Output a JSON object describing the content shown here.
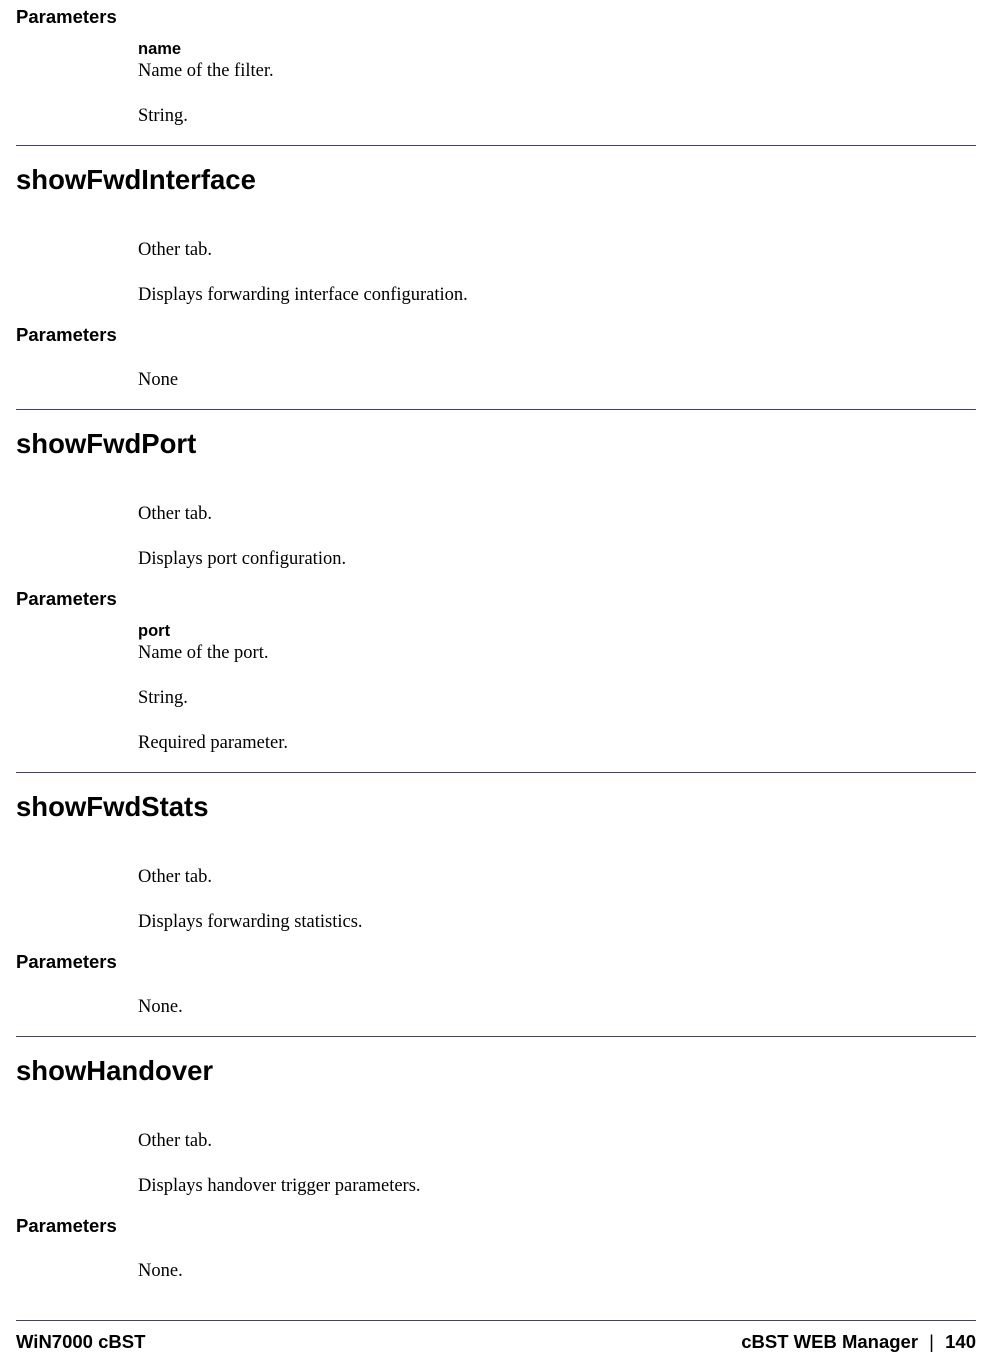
{
  "sections": [
    {
      "heading": null,
      "parameters_label": "Parameters",
      "param_name": "name",
      "lines": [
        "Name of the filter.",
        "String."
      ]
    },
    {
      "heading": "showFwdInterface",
      "intro": [
        "Other tab.",
        "Displays forwarding interface configuration."
      ],
      "parameters_label": "Parameters",
      "lines": [
        "None"
      ]
    },
    {
      "heading": "showFwdPort",
      "intro": [
        "Other tab.",
        "Displays port configuration."
      ],
      "parameters_label": "Parameters",
      "param_name": "port",
      "lines": [
        "Name of the port.",
        "String.",
        "Required parameter."
      ]
    },
    {
      "heading": "showFwdStats",
      "intro": [
        "Other tab.",
        "Displays forwarding statistics."
      ],
      "parameters_label": "Parameters",
      "lines": [
        "None."
      ]
    },
    {
      "heading": "showHandover",
      "intro": [
        "Other tab.",
        "Displays handover trigger parameters."
      ],
      "parameters_label": "Parameters",
      "lines": [
        "None."
      ]
    }
  ],
  "footer": {
    "left": "WiN7000 cBST",
    "right_label": "cBST WEB Manager",
    "page": "140"
  }
}
